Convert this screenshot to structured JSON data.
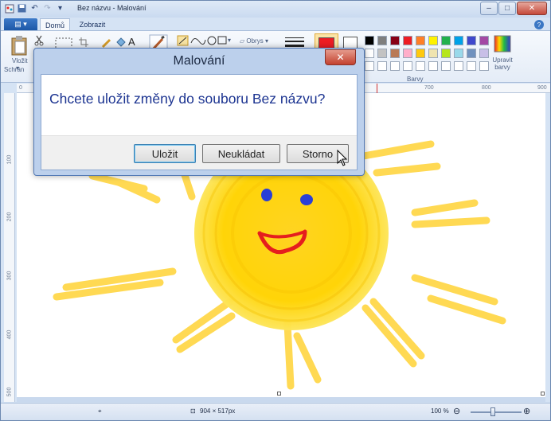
{
  "window": {
    "title": "Bez názvu - Malování",
    "controls": [
      "–",
      "□",
      "✕"
    ]
  },
  "ribbon": {
    "file_label": "",
    "tabs": [
      {
        "label": "Domů"
      },
      {
        "label": "Zobrazit"
      }
    ],
    "paste_label": "Vložit",
    "clipboard_group": "Schrán",
    "shapes_outline": "Obrys",
    "colors_group": "Barvy",
    "edit_colors_label": "Upravit barvy",
    "palette": [
      "#000000",
      "#7f7f7f",
      "#880015",
      "#ed1c24",
      "#ff7f27",
      "#fff200",
      "#22b14c",
      "#00a2e8",
      "#3f48cc",
      "#a349a4",
      "#ffffff",
      "#c3c3c3",
      "#b97a57",
      "#ffaec9",
      "#ffc90e",
      "#efe4b0",
      "#b5e61d",
      "#99d9ea",
      "#7092be",
      "#c8bfe7"
    ],
    "color1": "#ed1c24",
    "color2": "#ffffff"
  },
  "ruler": {
    "h_ticks": [
      "0",
      "700",
      "800",
      "900"
    ],
    "v_ticks": [
      "100",
      "200",
      "300",
      "400",
      "500"
    ]
  },
  "statusbar": {
    "image_size": "904 × 517px",
    "zoom": "100 %"
  },
  "dialog": {
    "title": "Malování",
    "message": "Chcete uložit změny do souboru Bez názvu?",
    "save_label": "Uložit",
    "dont_save_label": "Neukládat",
    "cancel_label": "Storno"
  }
}
